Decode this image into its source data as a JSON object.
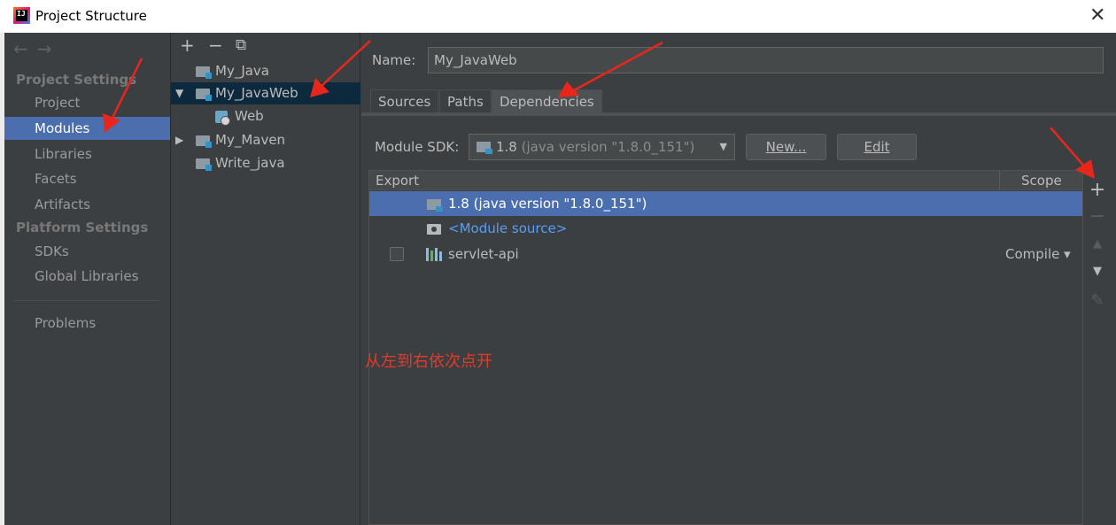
{
  "window": {
    "title": "Project Structure",
    "close_glyph": "✕",
    "logo_text": "IJ"
  },
  "sidebar": {
    "nav_back": "←",
    "nav_forward": "→",
    "project_settings_title": "Project Settings",
    "project_items": [
      "Project",
      "Modules",
      "Libraries",
      "Facets",
      "Artifacts"
    ],
    "selected_item": "Modules",
    "platform_settings_title": "Platform Settings",
    "platform_items": [
      "SDKs",
      "Global Libraries"
    ],
    "problems": "Problems"
  },
  "tree": {
    "toolbar": {
      "add": "+",
      "remove": "−",
      "copy": "⧉"
    },
    "rows": [
      {
        "label": "My_Java",
        "arrow": ""
      },
      {
        "label": "My_JavaWeb",
        "arrow": "▼",
        "selected": true
      },
      {
        "label": "Web",
        "arrow": ""
      },
      {
        "label": "My_Maven",
        "arrow": "▶"
      },
      {
        "label": "Write_java",
        "arrow": ""
      }
    ]
  },
  "main": {
    "name_label": "Name:",
    "name_value": "My_JavaWeb",
    "tabs": [
      "Sources",
      "Paths",
      "Dependencies"
    ],
    "active_tab": "Dependencies",
    "sdk_label": "Module SDK:",
    "sdk_value_main": "1.8",
    "sdk_value_detail": "(java version \"1.8.0_151\")",
    "sdk_dropdown_arrow": "▼",
    "new_button": "New...",
    "edit_button": "Edit",
    "table": {
      "headers": {
        "export": "Export",
        "scope": "Scope"
      },
      "rows": [
        {
          "text": "1.8 (java version \"1.8.0_151\")",
          "selected": true
        },
        {
          "text": "<Module source>"
        },
        {
          "text": "servlet-api",
          "scope": "Compile ▾",
          "checked": false
        }
      ]
    },
    "tools": {
      "add": "+",
      "remove": "−",
      "up": "▲",
      "down": "▼",
      "edit": "✎"
    }
  },
  "annotation": {
    "text": "从左到右依次点开",
    "color": "#e03b2b"
  },
  "colors": {
    "background": "#3c3f41",
    "selection": "#4b6eaf",
    "tree_selection": "#0d293e",
    "link": "#589df6"
  }
}
